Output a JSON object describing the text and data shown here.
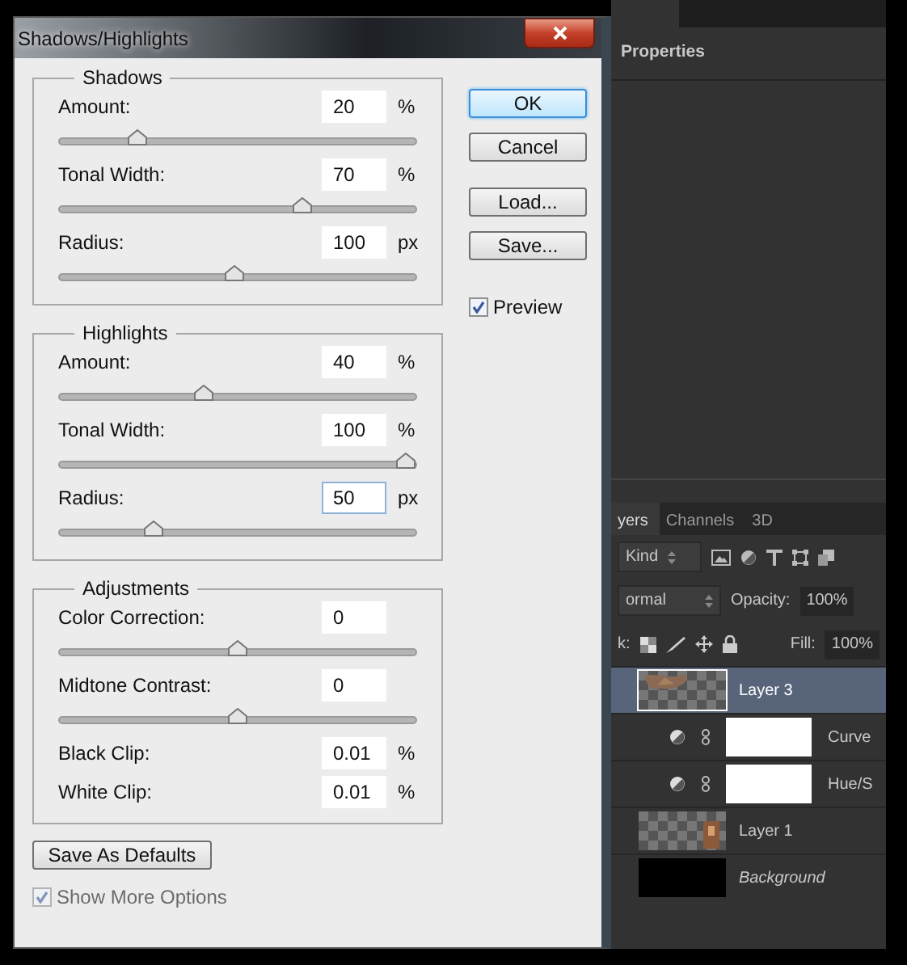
{
  "dialog": {
    "title": "Shadows/Highlights",
    "groups": [
      {
        "title": "Shadows",
        "rows": [
          {
            "kind": "slider",
            "label": "Amount:",
            "value": "20",
            "unit": "%",
            "level": 0.2,
            "focused": false
          },
          {
            "kind": "slider",
            "label": "Tonal Width:",
            "value": "70",
            "unit": "%",
            "level": 0.69,
            "focused": false
          },
          {
            "kind": "slider",
            "label": "Radius:",
            "value": "100",
            "unit": "px",
            "level": 0.49,
            "focused": false
          }
        ]
      },
      {
        "title": "Highlights",
        "rows": [
          {
            "kind": "slider",
            "label": "Amount:",
            "value": "40",
            "unit": "%",
            "level": 0.4,
            "focused": false
          },
          {
            "kind": "slider",
            "label": "Tonal Width:",
            "value": "100",
            "unit": "%",
            "level": 1,
            "focused": false
          },
          {
            "kind": "slider",
            "label": "Radius:",
            "value": "50",
            "unit": "px",
            "level": 0.25,
            "focused": true
          }
        ]
      },
      {
        "title": "Adjustments",
        "rows": [
          {
            "kind": "slider",
            "label": "Color Correction:",
            "value": "0",
            "level": 0.5,
            "focused": false
          },
          {
            "kind": "slider",
            "label": "Midtone Contrast:",
            "value": "0",
            "level": 0.5,
            "focused": false
          },
          {
            "kind": "field",
            "label": "Black Clip:",
            "value": "0.01",
            "unit": "%",
            "focused": false
          },
          {
            "kind": "field",
            "label": "White Clip:",
            "value": "0.01",
            "unit": "%",
            "focused": false
          }
        ]
      }
    ],
    "buttons": [
      {
        "label": "OK",
        "default": true
      },
      {
        "label": "Cancel",
        "default": false
      },
      {
        "label": "Load...",
        "default": false
      },
      {
        "label": "Save...",
        "default": false
      }
    ],
    "preview": {
      "label": "Preview",
      "checked": true
    },
    "save_defaults": {
      "label": "Save As Defaults"
    },
    "more_options": {
      "label": "Show More Options",
      "checked": true
    }
  },
  "properties_panel": {
    "title": "Properties"
  },
  "layers_panel": {
    "tabs": [
      {
        "label": "yers",
        "selected": true
      },
      {
        "label": "Channels",
        "selected": false
      },
      {
        "label": "3D",
        "selected": false
      }
    ],
    "filter": {
      "value": "Kind"
    },
    "blend_mode": {
      "value": "ormal"
    },
    "opacity": {
      "label": "Opacity:",
      "value": "100%"
    },
    "lock": {
      "label": "k:"
    },
    "fill": {
      "label": "Fill:",
      "value": "100%"
    },
    "layers": [
      {
        "kind": "pixel",
        "name": "Layer 3",
        "selected": true
      },
      {
        "kind": "adjustment",
        "name": "Curve",
        "selected": false
      },
      {
        "kind": "adjustment",
        "name": "Hue/S",
        "selected": false
      },
      {
        "kind": "pixel",
        "name": "Layer 1",
        "selected": false
      },
      {
        "kind": "background",
        "name": "Background",
        "selected": false
      }
    ]
  }
}
